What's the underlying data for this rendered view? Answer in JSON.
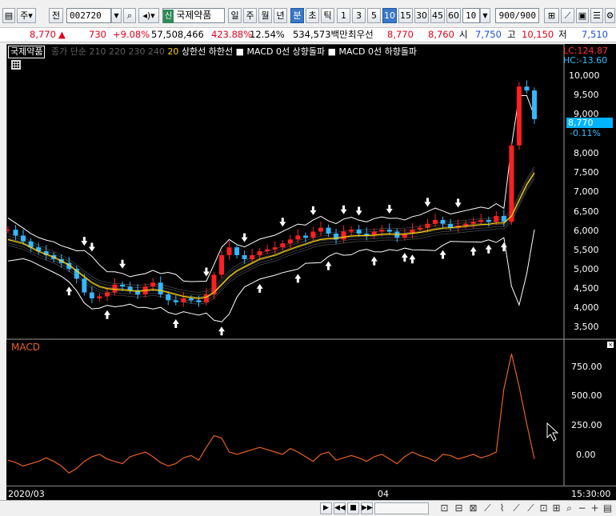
{
  "toolbar": {
    "period_prefix": "주",
    "period_label": "전",
    "code": "002720",
    "stock_tag": "신",
    "stock_name": "국제약품",
    "tabs": [
      "일",
      "주",
      "월",
      "년",
      "분",
      "초",
      "틱"
    ],
    "active_tab": "분",
    "intervals": [
      "1",
      "3",
      "5",
      "10",
      "15",
      "30",
      "45",
      "60"
    ],
    "active_interval": "10",
    "interval_select": "10",
    "count_value": "900/900"
  },
  "quote": {
    "price": "8,770",
    "change": "730",
    "change_pct": "+9.08%",
    "volume": "57,508,466",
    "volume_pct": "423.88%",
    "turnover": "12.54%",
    "amount": "534,573백만",
    "broker": "최우선",
    "ask": "8,770",
    "bid": "8,760",
    "open_label": "시",
    "open": "7,750",
    "high_label": "고",
    "high": "10,150",
    "low_label": "저",
    "low": "7,510"
  },
  "legend": {
    "name": "국제약품",
    "grey_text": "종가 단순 210  220  230  240",
    "yellow_text": "20",
    "white_text": "상한선 하한선 ■ MACD 0선 상향돌파 ■ MACD 0선 하향돌파"
  },
  "price_axis": {
    "lc": "LC:124.87",
    "hc": "HC:-13.60",
    "current": "8,770",
    "current_pct": "-0.11%",
    "ticks": [
      "10,000",
      "9,500",
      "9,000",
      "8,500",
      "8,000",
      "7,500",
      "7,000",
      "6,500",
      "6,000",
      "5,500",
      "5,000",
      "4,500",
      "4,000",
      "3,500"
    ]
  },
  "macd": {
    "title": "MACD",
    "ticks": [
      "750.00",
      "500.00",
      "250.00",
      "0.00"
    ]
  },
  "dates": {
    "start": "2020/03",
    "mid": "04",
    "time": "15:30:00"
  },
  "colors": {
    "candle_up": "#ff2020",
    "candle_down": "#35b6ff",
    "ma_yellow": "#ffd700",
    "band": "#ffffff",
    "macd": "#e8601e"
  },
  "chart_data": {
    "type": "line",
    "price_series": [
      {
        "name": "종가",
        "values": [
          5950,
          5800,
          5650,
          5500,
          5400,
          5300,
          5200,
          5100,
          4950,
          4700,
          4350,
          4200,
          4250,
          4350,
          4550,
          4500,
          4400,
          4300,
          4500,
          4600,
          4300,
          4150,
          4100,
          4200,
          4150,
          4100,
          4300,
          4800,
          5300,
          5500,
          5300,
          5200,
          5300,
          5400,
          5450,
          5500,
          5600,
          5700,
          5800,
          5750,
          5900,
          6000,
          5850,
          5700,
          5900,
          5950,
          5850,
          5800,
          5900,
          5950,
          5900,
          5750,
          5850,
          5950,
          6000,
          6100,
          6200,
          6100,
          6000,
          6050,
          6100,
          6150,
          6200,
          6150,
          6300,
          6150,
          8100,
          9600,
          9500,
          8770
        ]
      },
      {
        "name": "20",
        "values": [
          5700,
          5650,
          5600,
          5500,
          5400,
          5320,
          5250,
          5150,
          5050,
          4900,
          4750,
          4600,
          4500,
          4450,
          4430,
          4420,
          4400,
          4380,
          4400,
          4420,
          4400,
          4350,
          4300,
          4250,
          4220,
          4200,
          4230,
          4350,
          4550,
          4750,
          4900,
          5000,
          5100,
          5200,
          5250,
          5300,
          5380,
          5450,
          5520,
          5580,
          5650,
          5700,
          5720,
          5730,
          5760,
          5790,
          5800,
          5800,
          5810,
          5830,
          5840,
          5830,
          5840,
          5860,
          5880,
          5920,
          5960,
          5990,
          6000,
          6020,
          6040,
          6060,
          6080,
          6090,
          6120,
          6120,
          6300,
          6700,
          7100,
          7400
        ]
      }
    ],
    "macd_values": [
      -10,
      -30,
      -60,
      -40,
      -20,
      10,
      -20,
      -60,
      -120,
      -80,
      -20,
      20,
      40,
      0,
      -20,
      -40,
      20,
      40,
      60,
      20,
      -30,
      -60,
      -40,
      10,
      30,
      -10,
      100,
      200,
      180,
      60,
      40,
      60,
      80,
      100,
      80,
      60,
      40,
      90,
      60,
      20,
      -20,
      40,
      60,
      -10,
      10,
      30,
      10,
      -20,
      20,
      40,
      0,
      -40,
      20,
      60,
      30,
      10,
      -20,
      40,
      30,
      0,
      20,
      40,
      10,
      30,
      60,
      600,
      900,
      620,
      300,
      0
    ],
    "ylim": [
      3300,
      10400
    ],
    "macd_ylim": [
      -200,
      950
    ]
  }
}
